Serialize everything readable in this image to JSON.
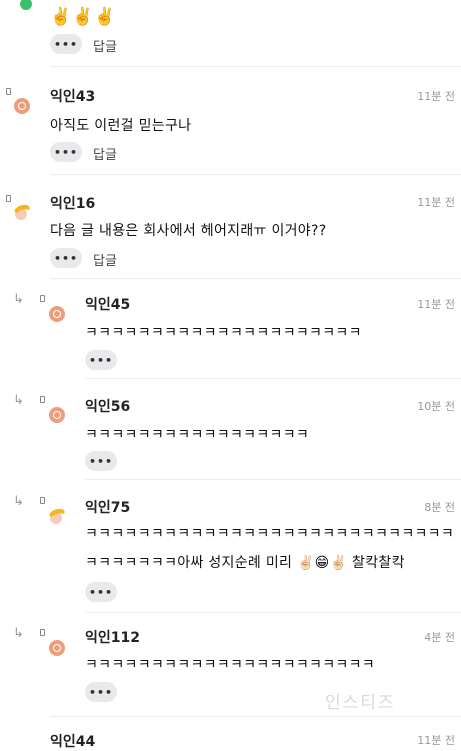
{
  "top": {
    "emojis": "✌️✌️✌️",
    "more_label": "•••",
    "reply_label": "답글"
  },
  "comments": [
    {
      "name": "익인43",
      "time": "11분 전",
      "text": "아직도 이런걸 믿는구나",
      "more": "•••",
      "reply": "답글"
    },
    {
      "name": "익인16",
      "time": "11분 전",
      "text": "다음 글 내용은 회사에서 헤어지래ㅠ 이거야??",
      "more": "•••",
      "reply": "답글"
    },
    {
      "name": "익인45",
      "time": "11분 전",
      "text": "ㅋㅋㅋㅋㅋㅋㅋㅋㅋㅋㅋㅋㅋㅋㅋㅋㅋㅋㅋㅋㅋ",
      "more": "•••"
    },
    {
      "name": "익인56",
      "time": "10분 전",
      "text": "ㅋㅋㅋㅋㅋㅋㅋㅋㅋㅋㅋㅋㅋㅋㅋㅋㅋ",
      "more": "•••"
    },
    {
      "name": "익인75",
      "time": "8분 전",
      "text_line1": "ㅋㅋㅋㅋㅋㅋㅋㅋㅋㅋㅋㅋㅋㅋㅋㅋㅋㅋㅋㅋㅋㅋㅋㅋㅋㅋㅋㅋ",
      "text_line2": "ㅋㅋㅋㅋㅋㅋㅋ아싸 성지순례 미리 ✌🏻😁✌🏻 찰칵찰칵",
      "more": "•••"
    },
    {
      "name": "익인112",
      "time": "4분 전",
      "text": "ㅋㅋㅋㅋㅋㅋㅋㅋㅋㅋㅋㅋㅋㅋㅋㅋㅋㅋㅋㅋㅋㅋ",
      "more": "•••"
    },
    {
      "name": "익인44",
      "time": "11분 전"
    }
  ],
  "watermark": "인스티즈",
  "colors": {
    "avatar": "#ee9d7a",
    "online": "#3bbf6a",
    "button_bg": "#e9e9ec"
  }
}
